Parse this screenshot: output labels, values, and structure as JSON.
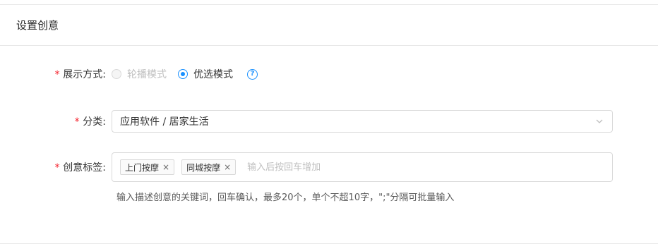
{
  "card": {
    "title": "设置创意"
  },
  "display_mode": {
    "required_mark": "*",
    "label": "展示方式:",
    "options": [
      {
        "label": "轮播模式",
        "state": "disabled"
      },
      {
        "label": "优选模式",
        "state": "checked"
      }
    ],
    "help_icon": "question-circle-icon"
  },
  "category": {
    "required_mark": "*",
    "label": "分类:",
    "value": "应用软件 / 居家生活",
    "icon": "chevron-down-icon"
  },
  "creative_tags": {
    "required_mark": "*",
    "label": "创意标签:",
    "tags": [
      "上门按摩",
      "同城按摩"
    ],
    "tag_close_glyph": "×",
    "placeholder": "输入后按回车增加",
    "hint": "输入描述创意的关键词，回车确认，最多20个，单个不超10字，\";\"分隔可批量输入"
  }
}
